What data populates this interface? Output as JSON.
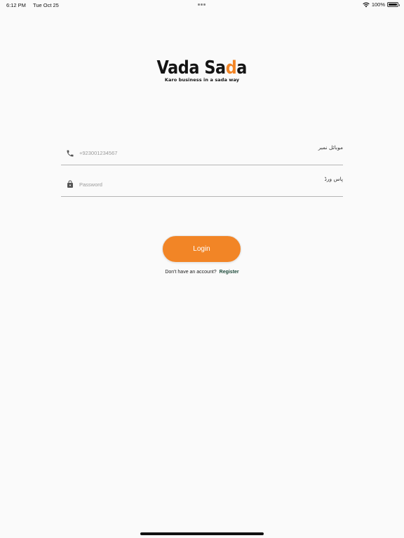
{
  "status_bar": {
    "time": "6:12 PM",
    "date": "Tue Oct 25",
    "battery_percent": "100%",
    "battery_level": 1.0
  },
  "logo": {
    "title_part1": "Vada Sa",
    "title_accent": "d",
    "title_part2": "a",
    "tagline": "Karo business in a sada way",
    "brand_color": "#f28526"
  },
  "form": {
    "phone": {
      "icon": "phone-icon",
      "placeholder": "+923001234567",
      "value": "",
      "label": "موبائل نمبر"
    },
    "password": {
      "icon": "lock-icon",
      "placeholder": "Password",
      "value": "",
      "label": "پاس ورڈ"
    }
  },
  "login_button": {
    "label": "Login",
    "color": "#f28526"
  },
  "register": {
    "prompt": "Don't have an account?",
    "link_label": "Register"
  }
}
